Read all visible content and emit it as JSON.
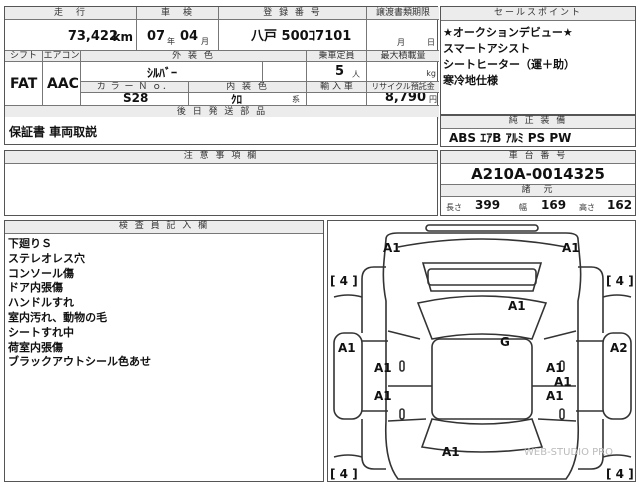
{
  "header": {
    "mileage_label": "走　行",
    "mileage_value": "73,422",
    "mileage_unit": "km",
    "inspection_label": "車　検",
    "inspection_year": "07",
    "inspection_year_unit": "年",
    "inspection_month": "04",
    "inspection_month_unit": "月",
    "registration_label": "登 録 番 号",
    "registration_value": "八戸 500ｺ7101",
    "transfer_label": "譲渡書類期限",
    "transfer_month": "月",
    "transfer_day": "日"
  },
  "row2": {
    "shift_label": "シフト",
    "shift_value": "FAT",
    "aircon_label": "エアコン",
    "aircon_value": "AAC",
    "exterior_label": "外 装 色",
    "exterior_value": "ｼﾙﾊﾞｰ",
    "color_no_label": "カ ラ ー Ｎ ｏ．",
    "color_no_value": "S28",
    "interior_label": "内 装 色",
    "interior_value": "ｸﾛ",
    "interior_unit": "系",
    "capacity_label": "乗車定員",
    "capacity_value": "5",
    "capacity_unit": "人",
    "load_label": "最大積載量",
    "load_unit": "kg",
    "import_label": "輸 入 車",
    "recycle_label": "リサイクル預託金",
    "recycle_value": "8,790",
    "recycle_unit": "円"
  },
  "sales_points": {
    "title": "セールスポイント",
    "lines": [
      "★オークションデビュー★",
      "スマートアシスト",
      "シートヒーター（運＋助）",
      "寒冷地仕様"
    ]
  },
  "accessories": {
    "title": "後 日 発 送 部 品",
    "value": "保証書 車両取説"
  },
  "equipment": {
    "title": "純 正 装 備",
    "value": "ABS ｴｱB ｱﾙﾐ PS PW"
  },
  "notes": {
    "title": "注 意 事 項 欄"
  },
  "chassis": {
    "title": "車 台 番 号",
    "value": "A210A-0014325",
    "dims_title": "諸　元",
    "length_label": "長さ",
    "length_value": "399",
    "width_label": "幅",
    "width_value": "169",
    "height_label": "高さ",
    "height_value": "162"
  },
  "inspector": {
    "title": "検 査 員 記 入 欄",
    "lines": [
      "下廻りＳ",
      "ステレオレス穴",
      "コンソール傷",
      "ドア内張傷",
      "ハンドルすれ",
      "室内汚れ、動物の毛",
      "シートすれ中",
      "荷室内張傷",
      "ブラックアウトシール色あせ"
    ]
  },
  "diagram": {
    "marks": [
      "A1",
      "A1",
      "A1",
      "G",
      "A1",
      "A2",
      "A1",
      "A1",
      "A1",
      "A1",
      "A1",
      "A1"
    ],
    "tires": [
      "4",
      "4",
      "4",
      "4"
    ],
    "watermark": "WEB-STUDIO PRO"
  }
}
